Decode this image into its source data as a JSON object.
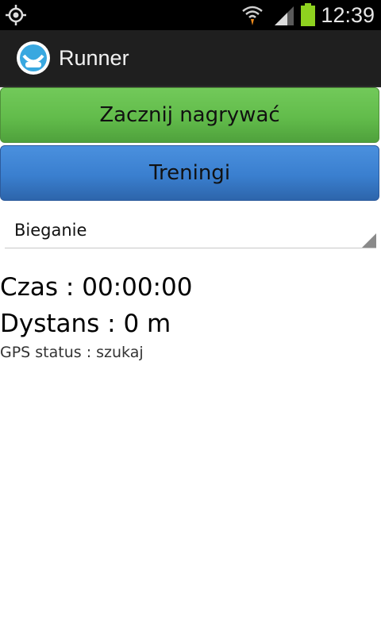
{
  "status_bar": {
    "time": "12:39",
    "icons": [
      "gps-icon",
      "wifi-icon",
      "signal-icon",
      "battery-icon"
    ],
    "battery_color": "#8ed21f"
  },
  "action_bar": {
    "title": "Runner",
    "icon": "app-icon"
  },
  "buttons": {
    "start_label": "Zacznij nagrywać",
    "trainings_label": "Treningi",
    "start_color": "#62bc4b",
    "trainings_color": "#3a7fcf"
  },
  "activity_spinner": {
    "selected": "Bieganie"
  },
  "stats": {
    "time": "Czas : 00:00:00",
    "distance": "Dystans : 0 m",
    "gps_status": "GPS status : szukaj"
  }
}
